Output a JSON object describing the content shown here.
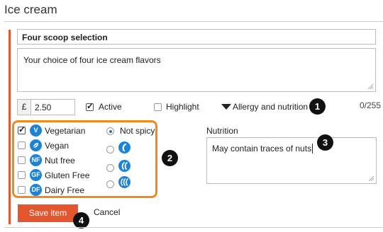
{
  "page": {
    "title": "Ice cream"
  },
  "item": {
    "name": "Four scoop selection",
    "description": "Your choice of four ice cream flavors",
    "char_count": "0/255",
    "currency_symbol": "£",
    "price": "2.50",
    "active_label": "Active",
    "active_checked": true,
    "highlight_label": "Highlight",
    "highlight_checked": false,
    "allergy_toggle_label": "Allergy and nutrition"
  },
  "dietary": [
    {
      "label": "Vegetarian",
      "badge": "V",
      "checked": true
    },
    {
      "label": "Vegan",
      "badge": "leaf",
      "checked": false
    },
    {
      "label": "Nut free",
      "badge": "NF",
      "checked": false
    },
    {
      "label": "Gluten Free",
      "badge": "GF",
      "checked": false
    },
    {
      "label": "Dairy Free",
      "badge": "DF",
      "checked": false
    }
  ],
  "spice": {
    "selected_label": "Not spicy",
    "options": [
      "not-spicy",
      "mild-chili",
      "medium-chili",
      "hot-chili"
    ]
  },
  "nutrition": {
    "label": "Nutrition",
    "value": "May contain traces of nuts"
  },
  "actions": {
    "save_label": "Save item",
    "cancel_label": "Cancel"
  },
  "callouts": [
    "1",
    "2",
    "3",
    "4"
  ],
  "colors": {
    "accent": "#e4572e",
    "highlight_box": "#f08a1c",
    "badge": "#1d83d6",
    "callout": "#111111"
  }
}
